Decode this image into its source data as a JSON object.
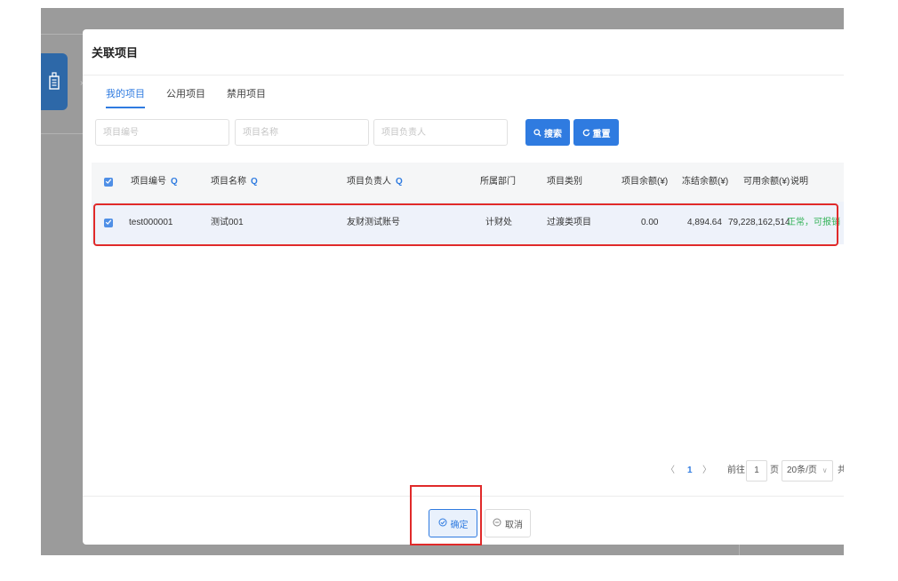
{
  "dialog": {
    "title": "关联项目"
  },
  "tabs": [
    {
      "label": "我的项目",
      "active": true
    },
    {
      "label": "公用项目",
      "active": false
    },
    {
      "label": "禁用项目",
      "active": false
    }
  ],
  "filters": {
    "project_code_placeholder": "项目编号",
    "project_name_placeholder": "项目名称",
    "project_owner_placeholder": "项目负责人",
    "search_label": "搜索",
    "reset_label": "重置"
  },
  "table": {
    "headers": {
      "code": "项目编号",
      "name": "项目名称",
      "owner": "项目负责人",
      "dept": "所属部门",
      "category": "项目类别",
      "balance": "项目余额(¥)",
      "frozen": "冻结余额(¥)",
      "available": "可用余额(¥)",
      "note": "说明"
    },
    "header_checked": true,
    "rows": [
      {
        "checked": true,
        "code": "test000001",
        "name": "测试001",
        "owner": "友财测试账号",
        "dept": "计财处",
        "category": "过渡类项目",
        "balance": "0.00",
        "frozen": "4,894.64",
        "available": "79,228,162,514",
        "note": "正常，可报销"
      }
    ]
  },
  "pagination": {
    "prev": "〈",
    "current": "1",
    "next": "〉",
    "goto_label": "前往",
    "goto_value": "1",
    "page_suffix": "页",
    "page_size": "20条/页",
    "total_prefix": "共"
  },
  "footer": {
    "confirm_label": "确定",
    "cancel_label": "取消"
  },
  "colors": {
    "primary": "#2f7be0",
    "success": "#36b35a",
    "highlight": "#e02a2a"
  }
}
